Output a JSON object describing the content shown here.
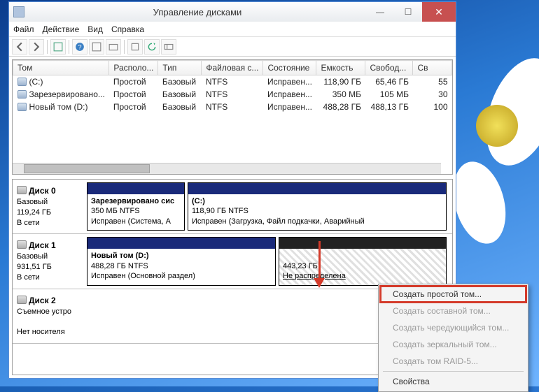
{
  "window": {
    "title": "Управление дисками"
  },
  "menu": {
    "file": "Файл",
    "action": "Действие",
    "view": "Вид",
    "help": "Справка"
  },
  "columns": {
    "vol": "Том",
    "layout": "Располо...",
    "type": "Тип",
    "fs": "Файловая с...",
    "status": "Состояние",
    "capacity": "Емкость",
    "free": "Свобод...",
    "pct": "Св"
  },
  "volumes": [
    {
      "name": "(C:)",
      "layout": "Простой",
      "type": "Базовый",
      "fs": "NTFS",
      "status": "Исправен...",
      "cap": "118,90 ГБ",
      "free": "65,46 ГБ",
      "pct": "55"
    },
    {
      "name": "Зарезервировано...",
      "layout": "Простой",
      "type": "Базовый",
      "fs": "NTFS",
      "status": "Исправен...",
      "cap": "350 МБ",
      "free": "105 МБ",
      "pct": "30"
    },
    {
      "name": "Новый том (D:)",
      "layout": "Простой",
      "type": "Базовый",
      "fs": "NTFS",
      "status": "Исправен...",
      "cap": "488,28 ГБ",
      "free": "488,13 ГБ",
      "pct": "100"
    }
  ],
  "disks": {
    "d0": {
      "title": "Диск 0",
      "type": "Базовый",
      "size": "119,24 ГБ",
      "state": "В сети",
      "p0": {
        "name": "Зарезервировано сис",
        "size": "350 МБ NTFS",
        "status": "Исправен (Система, А"
      },
      "p1": {
        "name": "(C:)",
        "size": "118,90 ГБ NTFS",
        "status": "Исправен (Загрузка, Файл подкачки, Аварийный"
      }
    },
    "d1": {
      "title": "Диск 1",
      "type": "Базовый",
      "size": "931,51 ГБ",
      "state": "В сети",
      "p0": {
        "name": "Новый том  (D:)",
        "size": "488,28 ГБ NTFS",
        "status": "Исправен (Основной раздел)"
      },
      "p1": {
        "size": "443,23 ГБ",
        "status": "Не распределена"
      }
    },
    "d2": {
      "title": "Диск 2",
      "type": "Съемное устро",
      "state": "Нет носителя"
    }
  },
  "ctx": {
    "simple": "Создать простой том...",
    "spanned": "Создать составной том...",
    "striped": "Создать чередующийся том...",
    "mirror": "Создать зеркальный том...",
    "raid5": "Создать том RAID-5...",
    "props": "Свойства"
  }
}
